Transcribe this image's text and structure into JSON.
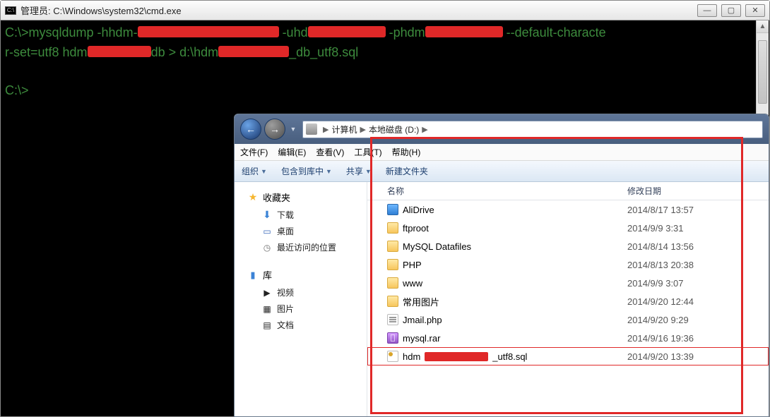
{
  "cmd": {
    "icon_label": "C:\\",
    "title": "管理员: C:\\Windows\\system32\\cmd.exe",
    "btn_min": "—",
    "btn_max": "▢",
    "btn_close": "✕",
    "line1a": "C:\\>mysqldump -hhdm-",
    "line1b": " -uhd",
    "line1c": " -phdm",
    "line1d": " --default-characte",
    "line2a": "r-set=utf8 hdm",
    "line2b": "db > d:\\hdm",
    "line2c": "_db_utf8.sql",
    "line3": "C:\\>"
  },
  "explorer": {
    "nav_back": "←",
    "nav_fwd": "→",
    "nav_drop": "▼",
    "crumb1": "计算机",
    "crumb2": "本地磁盘 (D:)",
    "menu": {
      "file": "文件(F)",
      "edit": "编辑(E)",
      "view": "查看(V)",
      "tool": "工具(T)",
      "help": "帮助(H)"
    },
    "toolbar": {
      "org": "组织",
      "include": "包含到库中",
      "share": "共享",
      "newfolder": "新建文件夹"
    },
    "nav_pane": {
      "fav": "收藏夹",
      "downloads": "下载",
      "desktop": "桌面",
      "recent": "最近访问的位置",
      "libs": "库",
      "videos": "视频",
      "pictures": "图片",
      "docs": "文档"
    },
    "cols": {
      "name": "名称",
      "date": "修改日期"
    },
    "files": [
      {
        "name": "AliDrive",
        "date": "2014/8/17 13:57",
        "icon": "blue"
      },
      {
        "name": "ftproot",
        "date": "2014/9/9 3:31",
        "icon": "fold"
      },
      {
        "name": "MySQL Datafiles",
        "date": "2014/8/14 13:56",
        "icon": "fold"
      },
      {
        "name": "PHP",
        "date": "2014/8/13 20:38",
        "icon": "fold"
      },
      {
        "name": "www",
        "date": "2014/9/9 3:07",
        "icon": "fold"
      },
      {
        "name": "常用图片",
        "date": "2014/9/20 12:44",
        "icon": "fold"
      },
      {
        "name": "Jmail.php",
        "date": "2014/9/20 9:29",
        "icon": "php"
      },
      {
        "name": "mysql.rar",
        "date": "2014/9/16 19:36",
        "icon": "rar"
      },
      {
        "name_pre": "hdm",
        "name_suf": "_utf8.sql",
        "date": "2014/9/20 13:39",
        "icon": "sql",
        "redact": true,
        "highlight": true
      }
    ]
  }
}
